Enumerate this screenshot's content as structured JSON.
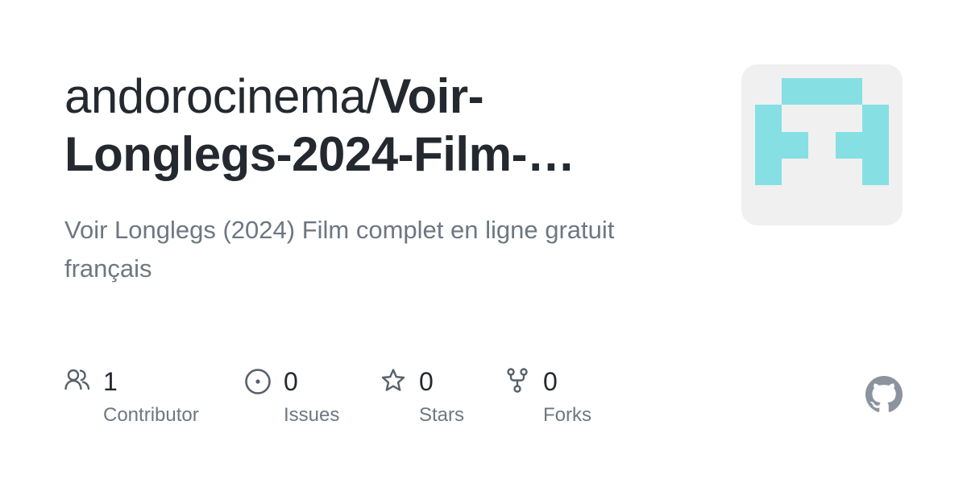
{
  "repository": {
    "owner_prefix": "andorocinema/",
    "name_line1": "Voir-",
    "name_line2": "Longlegs-2024-Film-…",
    "description": "Voir Longlegs (2024) Film complet en ligne gratuit français"
  },
  "avatar": {
    "icon": "identicon",
    "color": "#86e0e3",
    "background": "#f0f0f0"
  },
  "stats": [
    {
      "icon": "people-icon",
      "value": "1",
      "label": "Contributor"
    },
    {
      "icon": "issue-opened-icon",
      "value": "0",
      "label": "Issues"
    },
    {
      "icon": "star-icon",
      "value": "0",
      "label": "Stars"
    },
    {
      "icon": "repo-forked-icon",
      "value": "0",
      "label": "Forks"
    }
  ],
  "branding": {
    "icon": "github-mark-icon",
    "color": "#8b949e"
  }
}
